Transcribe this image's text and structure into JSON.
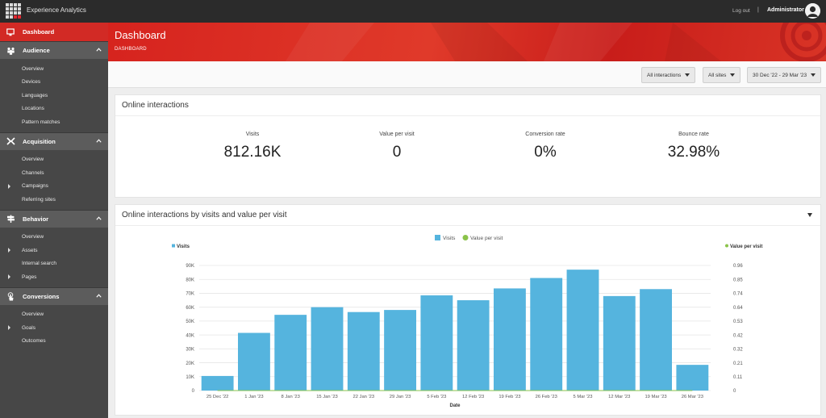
{
  "app": {
    "title": "Experience Analytics",
    "logout": "Log out",
    "separator": "|",
    "user": "Administrator"
  },
  "sidebar": {
    "active": "Dashboard",
    "groups": [
      {
        "label": "Audience",
        "items": [
          {
            "label": "Overview",
            "expandable": false
          },
          {
            "label": "Devices",
            "expandable": false
          },
          {
            "label": "Languages",
            "expandable": false
          },
          {
            "label": "Locations",
            "expandable": false
          },
          {
            "label": "Pattern matches",
            "expandable": false
          }
        ]
      },
      {
        "label": "Acquisition",
        "items": [
          {
            "label": "Overview",
            "expandable": false
          },
          {
            "label": "Channels",
            "expandable": false
          },
          {
            "label": "Campaigns",
            "expandable": true
          },
          {
            "label": "Referring sites",
            "expandable": false
          }
        ]
      },
      {
        "label": "Behavior",
        "items": [
          {
            "label": "Overview",
            "expandable": false
          },
          {
            "label": "Assets",
            "expandable": true
          },
          {
            "label": "Internal search",
            "expandable": false
          },
          {
            "label": "Pages",
            "expandable": true
          }
        ]
      },
      {
        "label": "Conversions",
        "items": [
          {
            "label": "Overview",
            "expandable": false
          },
          {
            "label": "Goals",
            "expandable": true
          },
          {
            "label": "Outcomes",
            "expandable": false
          }
        ]
      }
    ]
  },
  "header": {
    "title": "Dashboard",
    "breadcrumb": "DASHBOARD"
  },
  "filters": {
    "interactions": "All interactions",
    "sites": "All sites",
    "date_range": "30 Dec '22 - 29 Mar '23"
  },
  "online_interactions": {
    "title": "Online interactions",
    "kpis": [
      {
        "label": "Visits",
        "value": "812.16K"
      },
      {
        "label": "Value per visit",
        "value": "0"
      },
      {
        "label": "Conversion rate",
        "value": "0%"
      },
      {
        "label": "Bounce rate",
        "value": "32.98%"
      }
    ]
  },
  "chart_panel": {
    "title": "Online interactions by visits and value per visit"
  },
  "chart_data": {
    "type": "bar",
    "categories": [
      "25 Dec '22",
      "1 Jan '23",
      "8 Jan '23",
      "15 Jan '23",
      "22 Jan '23",
      "29 Jan '23",
      "5 Feb '23",
      "12 Feb '23",
      "19 Feb '23",
      "26 Feb '23",
      "5 Mar '23",
      "12 Mar '23",
      "19 Mar '23",
      "26 Mar '23"
    ],
    "series": [
      {
        "name": "Visits",
        "axis": "left",
        "color": "#55b4de",
        "values": [
          10500,
          41500,
          54500,
          60000,
          56500,
          58000,
          68500,
          65000,
          73500,
          81000,
          87000,
          68000,
          73000,
          18500
        ]
      },
      {
        "name": "Value per visit",
        "axis": "right",
        "color": "#8bc34a",
        "values": [
          0,
          0,
          0,
          0,
          0,
          0,
          0,
          0,
          0,
          0,
          0,
          0,
          0,
          0
        ]
      }
    ],
    "xlabel": "Date",
    "y_left": {
      "label": "Visits",
      "ticks": [
        "0",
        "10K",
        "20K",
        "30K",
        "40K",
        "50K",
        "60K",
        "70K",
        "80K",
        "90K"
      ],
      "range": [
        0,
        90000
      ]
    },
    "y_right": {
      "label": "Value per visit",
      "ticks": [
        "0",
        "0.11",
        "0.21",
        "0.32",
        "0.42",
        "0.53",
        "0.64",
        "0.74",
        "0.85",
        "0.96"
      ],
      "range": [
        0,
        0.96
      ]
    },
    "legend": "top-center",
    "grid": true
  }
}
